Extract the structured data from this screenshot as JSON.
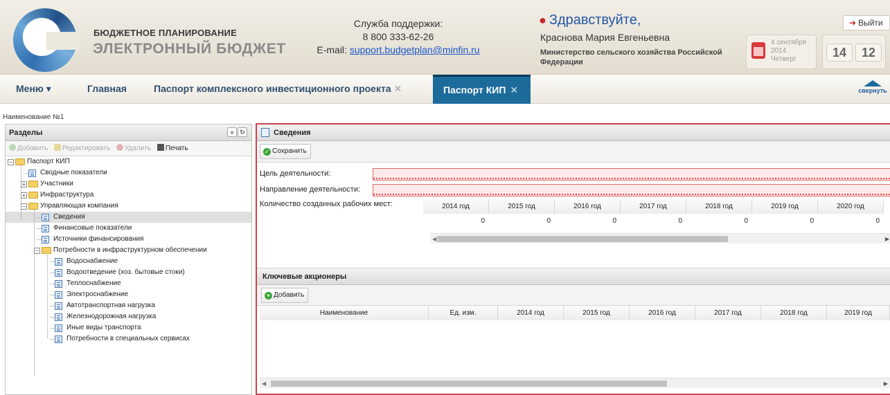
{
  "header": {
    "logo_line1": "БЮДЖЕТНОЕ ПЛАНИРОВАНИЕ",
    "logo_line2": "ЭЛЕКТРОННЫЙ БЮДЖЕТ",
    "support_title": "Служба поддержки:",
    "support_phone": "8 800 333-62-26",
    "support_email_label": "E-mail: ",
    "support_email": "support.budgetplan@minfin.ru",
    "greeting": "Здравствуйте,",
    "user_name": "Краснова Мария Евгеньевна",
    "organization": "Министерство сельского хозяйства Российской Федерации",
    "date_day": "4 сентября",
    "date_year": "2014",
    "date_weekday": "Четверг",
    "clock_hours": "14",
    "clock_minutes": "12",
    "logout_label": "Выйти"
  },
  "nav": {
    "menu_label": "Меню ▾",
    "home_label": "Главная",
    "tab1_label": "Паспорт комплексного инвестиционного проекта",
    "tab2_label": "Паспорт КИП",
    "close_glyph": "✕",
    "collapse_label": "свернуть"
  },
  "breadcrumb": "Наименование №1",
  "left_panel": {
    "title": "Разделы",
    "toolbar": {
      "add": "Добавить",
      "edit": "Редактировать",
      "delete": "Удалить",
      "print": "Печать"
    },
    "tree": [
      {
        "label": "Паспорт КИП",
        "level": 0,
        "type": "folder",
        "expander": "minus"
      },
      {
        "label": "Сводные показатели",
        "level": 1,
        "type": "doc"
      },
      {
        "label": "Участники",
        "level": 1,
        "type": "folder",
        "expander": "plus"
      },
      {
        "label": "Инфраструктура",
        "level": 1,
        "type": "folder",
        "expander": "plus"
      },
      {
        "label": "Управляющая компания",
        "level": 1,
        "type": "folder",
        "expander": "minus"
      },
      {
        "label": "Сведения",
        "level": 2,
        "type": "doc",
        "selected": true
      },
      {
        "label": "Финансовые показатели",
        "level": 2,
        "type": "doc"
      },
      {
        "label": "Источники финансирования",
        "level": 2,
        "type": "doc"
      },
      {
        "label": "Потребности в инфраструктурном обеспечении",
        "level": 2,
        "type": "folder",
        "expander": "minus"
      },
      {
        "label": "Водоснабжение",
        "level": 3,
        "type": "doc"
      },
      {
        "label": "Водоотведение (хоз. бытовые стоки)",
        "level": 3,
        "type": "doc"
      },
      {
        "label": "Теплоснабжение",
        "level": 3,
        "type": "doc"
      },
      {
        "label": "Электроснабжение",
        "level": 3,
        "type": "doc"
      },
      {
        "label": "Автотранспортная нагрузка",
        "level": 3,
        "type": "doc"
      },
      {
        "label": "Железнодорожная нагрузка",
        "level": 3,
        "type": "doc"
      },
      {
        "label": "Иные виды транспорта",
        "level": 3,
        "type": "doc"
      },
      {
        "label": "Потребности в специальных сервисах",
        "level": 3,
        "type": "doc"
      }
    ]
  },
  "right_panel": {
    "title": "Сведения",
    "save_label": "Сохранить",
    "goal_label": "Цель деятельности:",
    "goal_value": "",
    "direction_label": "Направление деятельности:",
    "direction_value": "",
    "jobs_label": "Количество созданных рабочих мест:",
    "jobs_years": [
      "2014 год",
      "2015 год",
      "2016 год",
      "2017 год",
      "2018 год",
      "2019 год",
      "2020 год"
    ],
    "jobs_values": [
      "0",
      "0",
      "0",
      "0",
      "0",
      "0",
      "0"
    ],
    "shareholders_title": "Ключевые акционеры",
    "add_label": "Добавить",
    "shareholders_columns": [
      "Наименование",
      "Ед. изм.",
      "2014 год",
      "2015 год",
      "2016 год",
      "2017 год",
      "2018 год",
      "2019 год"
    ]
  },
  "colors": {
    "accent_tab": "#1c6b9b",
    "invalid_border": "#e06a6a",
    "panel_border_active": "#c8414b",
    "link": "#1a56c8",
    "greeting": "#2557a5"
  }
}
